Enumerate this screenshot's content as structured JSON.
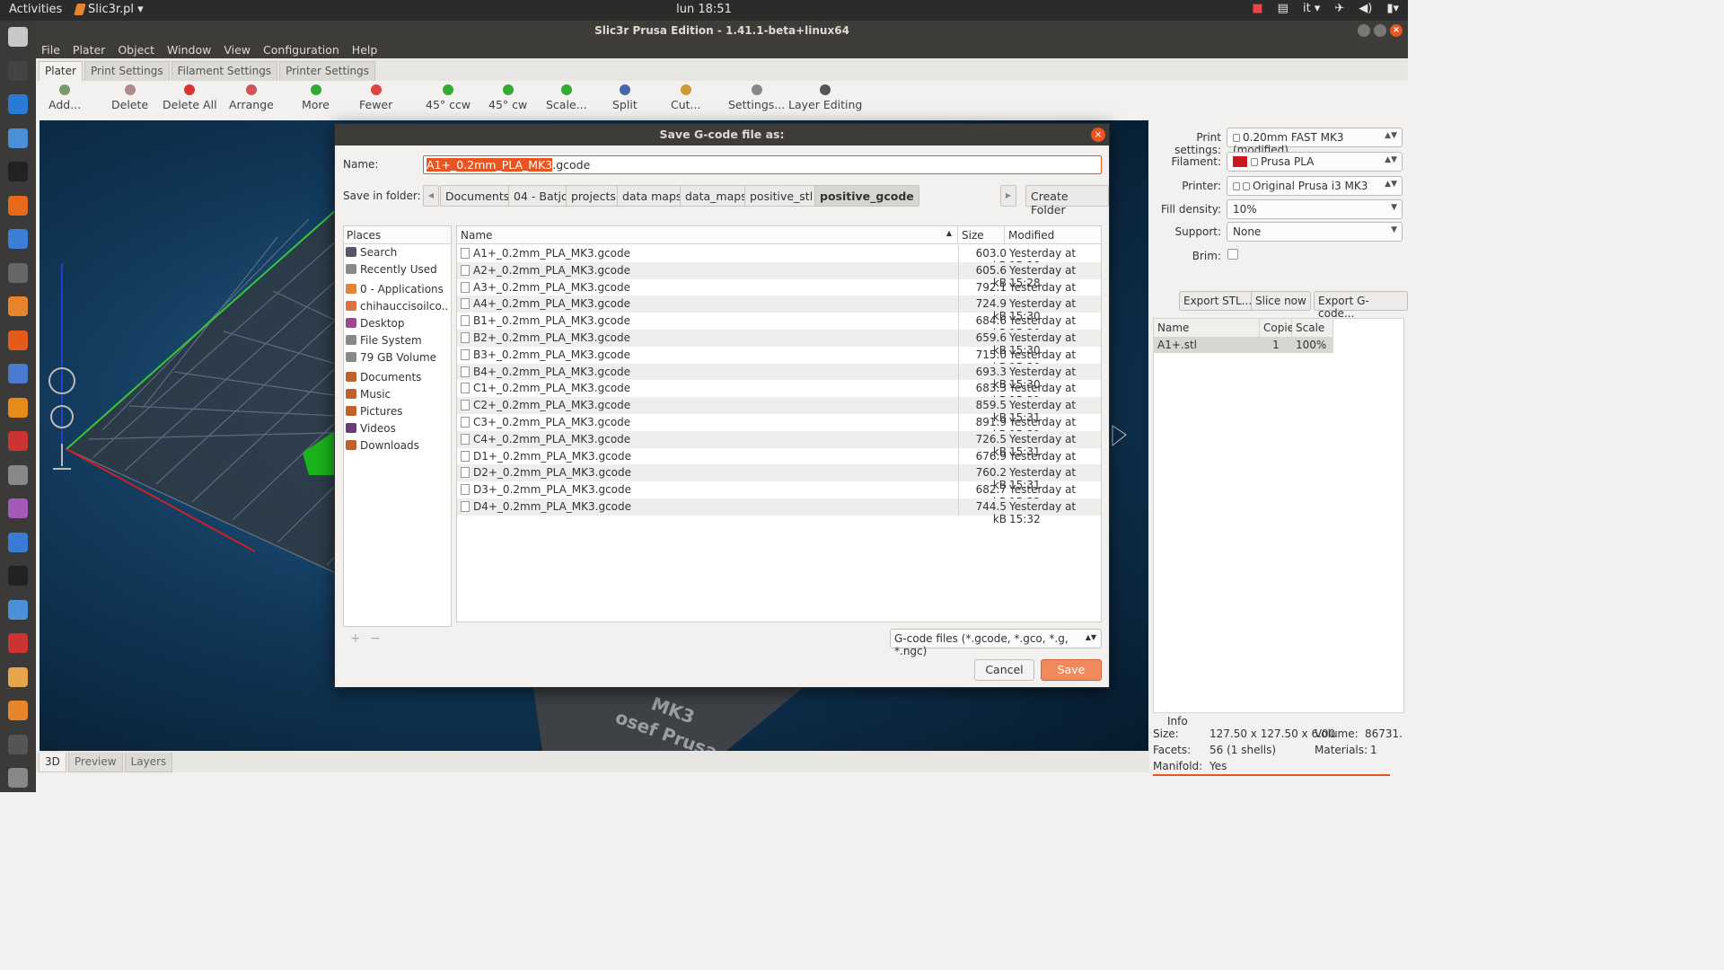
{
  "topbar": {
    "activities": "Activities",
    "app_menu": "Slic3r.pl ▾",
    "clock": "lun 18:51",
    "lang": "it ▾",
    "colors": {
      "bg": "#2b2b2b",
      "accent": "#e95420"
    }
  },
  "window": {
    "title": "Slic3r Prusa Edition - 1.41.1-beta+linux64"
  },
  "menubar": [
    "File",
    "Plater",
    "Object",
    "Window",
    "View",
    "Configuration",
    "Help"
  ],
  "tabs": [
    "Plater",
    "Print Settings",
    "Filament Settings",
    "Printer Settings"
  ],
  "toolbar": [
    {
      "label": "Add...",
      "icon": "add-icon",
      "color": "#7a9a6a"
    },
    {
      "label": "Delete",
      "icon": "delete-icon",
      "color": "#b08a8a"
    },
    {
      "label": "Delete All",
      "icon": "delete-all-icon",
      "color": "#d33"
    },
    {
      "label": "Arrange",
      "icon": "arrange-icon",
      "color": "#c55"
    },
    {
      "label": "More",
      "icon": "more-icon",
      "color": "#3a3"
    },
    {
      "label": "Fewer",
      "icon": "fewer-icon",
      "color": "#d44"
    },
    {
      "label": "45° ccw",
      "icon": "rotate-ccw-icon",
      "color": "#3a3"
    },
    {
      "label": "45° cw",
      "icon": "rotate-cw-icon",
      "color": "#3a3"
    },
    {
      "label": "Scale...",
      "icon": "scale-icon",
      "color": "#3a3"
    },
    {
      "label": "Split",
      "icon": "split-icon",
      "color": "#46a"
    },
    {
      "label": "Cut...",
      "icon": "cut-icon",
      "color": "#c93"
    },
    {
      "label": "Settings...",
      "icon": "settings-icon",
      "color": "#888"
    },
    {
      "label": "Layer Editing",
      "icon": "layer-editing-icon",
      "color": "#555"
    }
  ],
  "canvas": {
    "bed_text_1": "MK3",
    "bed_text_2": "osef Prusa"
  },
  "view_tabs": [
    "3D",
    "Preview",
    "Layers"
  ],
  "right_panel": {
    "print_settings_label": "Print settings:",
    "print_settings_value": "0.20mm FAST MK3 (modified)",
    "filament_label": "Filament:",
    "filament_value": "Prusa PLA",
    "filament_color": "#c9181f",
    "printer_label": "Printer:",
    "printer_value": "Original Prusa i3 MK3",
    "fill_density_label": "Fill density:",
    "fill_density_value": "10%",
    "support_label": "Support:",
    "support_value": "None",
    "brim_label": "Brim:",
    "export_stl": "Export STL...",
    "slice_now": "Slice now",
    "export_gcode": "Export G-code...",
    "table_headers": [
      "Name",
      "Copie",
      "Scale"
    ],
    "table_row": [
      "A1+.stl",
      "1",
      "100%"
    ],
    "info_title": "Info",
    "size_label": "Size:",
    "size_value": "127.50 x 127.50 x 6.00",
    "volume_label": "Volume:",
    "volume_value": "86731.",
    "facets_label": "Facets:",
    "facets_value": "56 (1 shells)",
    "materials_label": "Materials:",
    "materials_value": "1",
    "manifold_label": "Manifold:",
    "manifold_value": "Yes"
  },
  "dialog": {
    "title": "Save G-code file as:",
    "name_label": "Name:",
    "name_selected": "A1+_0.2mm_PLA_MK3",
    "name_ext": ".gcode",
    "folder_label": "Save in folder:",
    "crumbs": [
      "Documents",
      "04 - Batjo",
      "projects",
      "data maps",
      "data_maps",
      "positive_stl",
      "positive_gcode"
    ],
    "create_folder": "Create Folder",
    "places_header": "Places",
    "places": [
      {
        "label": "Search",
        "icon": "search-icon",
        "color": "#556"
      },
      {
        "label": "Recently Used",
        "icon": "clock-icon",
        "color": "#888"
      },
      {
        "label": "0 - Applications",
        "icon": "folder-icon",
        "color": "#e0843a"
      },
      {
        "label": "chihauccisoilco...",
        "icon": "home-icon",
        "color": "#e07040"
      },
      {
        "label": "Desktop",
        "icon": "desktop-icon",
        "color": "#9b4a8a"
      },
      {
        "label": "File System",
        "icon": "drive-icon",
        "color": "#888"
      },
      {
        "label": "79 GB Volume",
        "icon": "drive-icon",
        "color": "#888"
      },
      {
        "label": "Documents",
        "icon": "documents-icon",
        "color": "#c0602a"
      },
      {
        "label": "Music",
        "icon": "music-icon",
        "color": "#c0602a"
      },
      {
        "label": "Pictures",
        "icon": "pictures-icon",
        "color": "#c0602a"
      },
      {
        "label": "Videos",
        "icon": "videos-icon",
        "color": "#6a3a7a"
      },
      {
        "label": "Downloads",
        "icon": "downloads-icon",
        "color": "#c0602a"
      }
    ],
    "file_headers": {
      "name": "Name",
      "size": "Size",
      "modified": "Modified"
    },
    "files": [
      {
        "name": "A1+_0.2mm_PLA_MK3.gcode",
        "size": "603.0 kB",
        "modified": "Yesterday at 15:28"
      },
      {
        "name": "A2+_0.2mm_PLA_MK3.gcode",
        "size": "605.6 kB",
        "modified": "Yesterday at 15:28"
      },
      {
        "name": "A3+_0.2mm_PLA_MK3.gcode",
        "size": "792.1 kB",
        "modified": "Yesterday at 15:29"
      },
      {
        "name": "A4+_0.2mm_PLA_MK3.gcode",
        "size": "724.9 kB",
        "modified": "Yesterday at 15:30"
      },
      {
        "name": "B1+_0.2mm_PLA_MK3.gcode",
        "size": "684.6 kB",
        "modified": "Yesterday at 15:30"
      },
      {
        "name": "B2+_0.2mm_PLA_MK3.gcode",
        "size": "659.6 kB",
        "modified": "Yesterday at 15:30"
      },
      {
        "name": "B3+_0.2mm_PLA_MK3.gcode",
        "size": "715.0 kB",
        "modified": "Yesterday at 15:30"
      },
      {
        "name": "B4+_0.2mm_PLA_MK3.gcode",
        "size": "693.3 kB",
        "modified": "Yesterday at 15:30"
      },
      {
        "name": "C1+_0.2mm_PLA_MK3.gcode",
        "size": "683.3 kB",
        "modified": "Yesterday at 15:31"
      },
      {
        "name": "C2+_0.2mm_PLA_MK3.gcode",
        "size": "859.5 kB",
        "modified": "Yesterday at 15:31"
      },
      {
        "name": "C3+_0.2mm_PLA_MK3.gcode",
        "size": "891.9 kB",
        "modified": "Yesterday at 15:31"
      },
      {
        "name": "C4+_0.2mm_PLA_MK3.gcode",
        "size": "726.5 kB",
        "modified": "Yesterday at 15:31"
      },
      {
        "name": "D1+_0.2mm_PLA_MK3.gcode",
        "size": "676.9 kB",
        "modified": "Yesterday at 15:31"
      },
      {
        "name": "D2+_0.2mm_PLA_MK3.gcode",
        "size": "760.2 kB",
        "modified": "Yesterday at 15:31"
      },
      {
        "name": "D3+_0.2mm_PLA_MK3.gcode",
        "size": "682.7 kB",
        "modified": "Yesterday at 15:32"
      },
      {
        "name": "D4+_0.2mm_PLA_MK3.gcode",
        "size": "744.5 kB",
        "modified": "Yesterday at 15:32"
      }
    ],
    "filter": "G-code files (*.gcode, *.gco, *.g, *.ngc)",
    "cancel": "Cancel",
    "save": "Save"
  }
}
